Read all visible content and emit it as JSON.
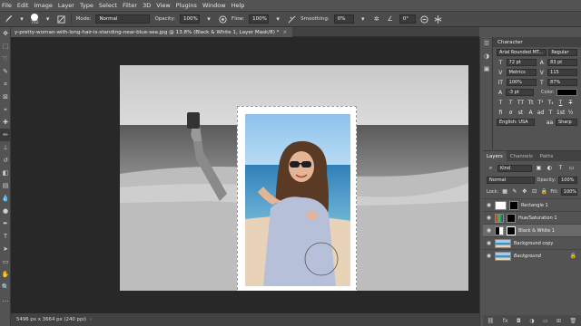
{
  "menu": [
    "File",
    "Edit",
    "Image",
    "Layer",
    "Type",
    "Select",
    "Filter",
    "3D",
    "View",
    "Plugins",
    "Window",
    "Help"
  ],
  "options": {
    "brush_size": "702",
    "mode_label": "Mode:",
    "mode_value": "Normal",
    "opacity_label": "Opacity:",
    "opacity_value": "100%",
    "flow_label": "Flow:",
    "flow_value": "100%",
    "smoothing_label": "Smoothing:",
    "smoothing_value": "0%",
    "angle_value": "0°"
  },
  "document": {
    "tab_title": "y-pretty-woman-with-long-hair-is-standing-near-blue-sea.jpg @ 13.8% (Black & White 1, Layer Mask/8) *",
    "status": "5496 px x 3664 px (240 ppi)"
  },
  "character": {
    "title": "Character",
    "font_family": "Arial Rounded MT...",
    "font_style": "Regular",
    "font_size": "72 pt",
    "leading": "83 pt",
    "kerning": "Metrics",
    "tracking": "115",
    "vscale": "100%",
    "hscale": "87%",
    "baseline": "-3 pt",
    "color_label": "Color:",
    "language": "English: USA",
    "antialias": "Sharp",
    "glyphs_row1": [
      "T",
      "T",
      "TT",
      "Tt",
      "T¹",
      "T₁",
      "T",
      "T"
    ],
    "glyphs_row2": [
      "fi",
      "σ",
      "st",
      "A",
      "ad",
      "T",
      "1st",
      "½"
    ]
  },
  "layers": {
    "tabs": [
      "Layers",
      "Channels",
      "Paths"
    ],
    "filter_label": "Kind",
    "blend_mode": "Normal",
    "opacity_label": "Opacity:",
    "opacity_value": "100%",
    "lock_label": "Lock:",
    "fill_label": "Fill:",
    "fill_value": "100%",
    "items": [
      {
        "name": "Rectangle 1",
        "selected": false,
        "italic": false
      },
      {
        "name": "Hue/Saturation 1",
        "selected": false,
        "italic": false
      },
      {
        "name": "Black & White 1",
        "selected": true,
        "italic": false
      },
      {
        "name": "Background copy",
        "selected": false,
        "italic": false
      },
      {
        "name": "Background",
        "selected": false,
        "italic": true
      }
    ],
    "footer_icons": [
      "link-icon",
      "fx-icon",
      "mask-icon",
      "adjustment-icon",
      "group-icon",
      "new-layer-icon",
      "trash-icon"
    ]
  },
  "colors": {
    "app_bg": "#535353",
    "workspace_bg": "#282828",
    "selected_layer": "#6a6a6a",
    "sky": "#9fcdf0",
    "sea": "#3f90c2"
  }
}
